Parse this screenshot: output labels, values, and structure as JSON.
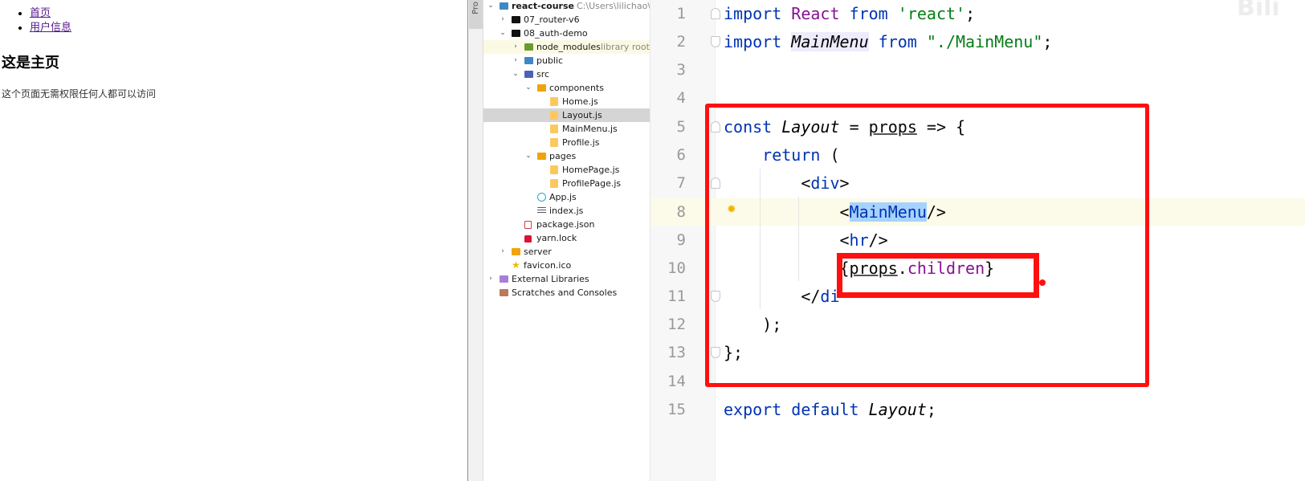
{
  "browser": {
    "nav": [
      {
        "label": "首页"
      },
      {
        "label": "用户信息"
      }
    ],
    "heading": "这是主页",
    "paragraph": "这个页面无需权限任何人都可以访问"
  },
  "toolstrip": {
    "tab_label": "Pro"
  },
  "project_tree": {
    "root": {
      "name": "react-course",
      "path": "C:\\Users\\lilichao\\De"
    },
    "items": [
      {
        "label": "07_router-v6"
      },
      {
        "label": "08_auth-demo"
      },
      {
        "label": "node_modules",
        "hint": "library root"
      },
      {
        "label": "public"
      },
      {
        "label": "src"
      },
      {
        "label": "components"
      },
      {
        "label": "Home.js"
      },
      {
        "label": "Layout.js"
      },
      {
        "label": "MainMenu.js"
      },
      {
        "label": "Profile.js"
      },
      {
        "label": "pages"
      },
      {
        "label": "HomePage.js"
      },
      {
        "label": "ProfilePage.js"
      },
      {
        "label": "App.js"
      },
      {
        "label": "index.js"
      },
      {
        "label": "package.json"
      },
      {
        "label": "yarn.lock"
      },
      {
        "label": "server"
      },
      {
        "label": "favicon.ico"
      },
      {
        "label": "External Libraries"
      },
      {
        "label": "Scratches and Consoles"
      }
    ]
  },
  "editor": {
    "line_numbers": [
      "1",
      "2",
      "3",
      "4",
      "5",
      "6",
      "7",
      "8",
      "9",
      "10",
      "11",
      "12",
      "13",
      "14",
      "15"
    ],
    "tokens": {
      "import": "import",
      "react_id": "React",
      "from": "from",
      "react_str": "'react'",
      "semi": ";",
      "mainmenu_id": "MainMenu",
      "mainmenu_str": "\"./MainMenu\"",
      "const": "const",
      "layout": "Layout",
      "eq": "=",
      "props": "props",
      "arrow": "=> {",
      "return": "return",
      "paren": "(",
      "div_open_lt": "<",
      "div": "div",
      "gt": ">",
      "mm_lt": "<",
      "mm": "MainMenu",
      "mm_close": "/>",
      "hr_lt": "<",
      "hr": "hr",
      "hr_close": "/>",
      "brace_open": "{",
      "dot": ".",
      "children": "children",
      "brace_close": "}",
      "div_close_lt": "</",
      "div_close_partial": "di",
      "end_paren": ");",
      "end_brace": "};",
      "export": "export",
      "default": "default",
      "layout_end": "Layout",
      "final_semi": ";"
    }
  },
  "watermark": "Bili"
}
